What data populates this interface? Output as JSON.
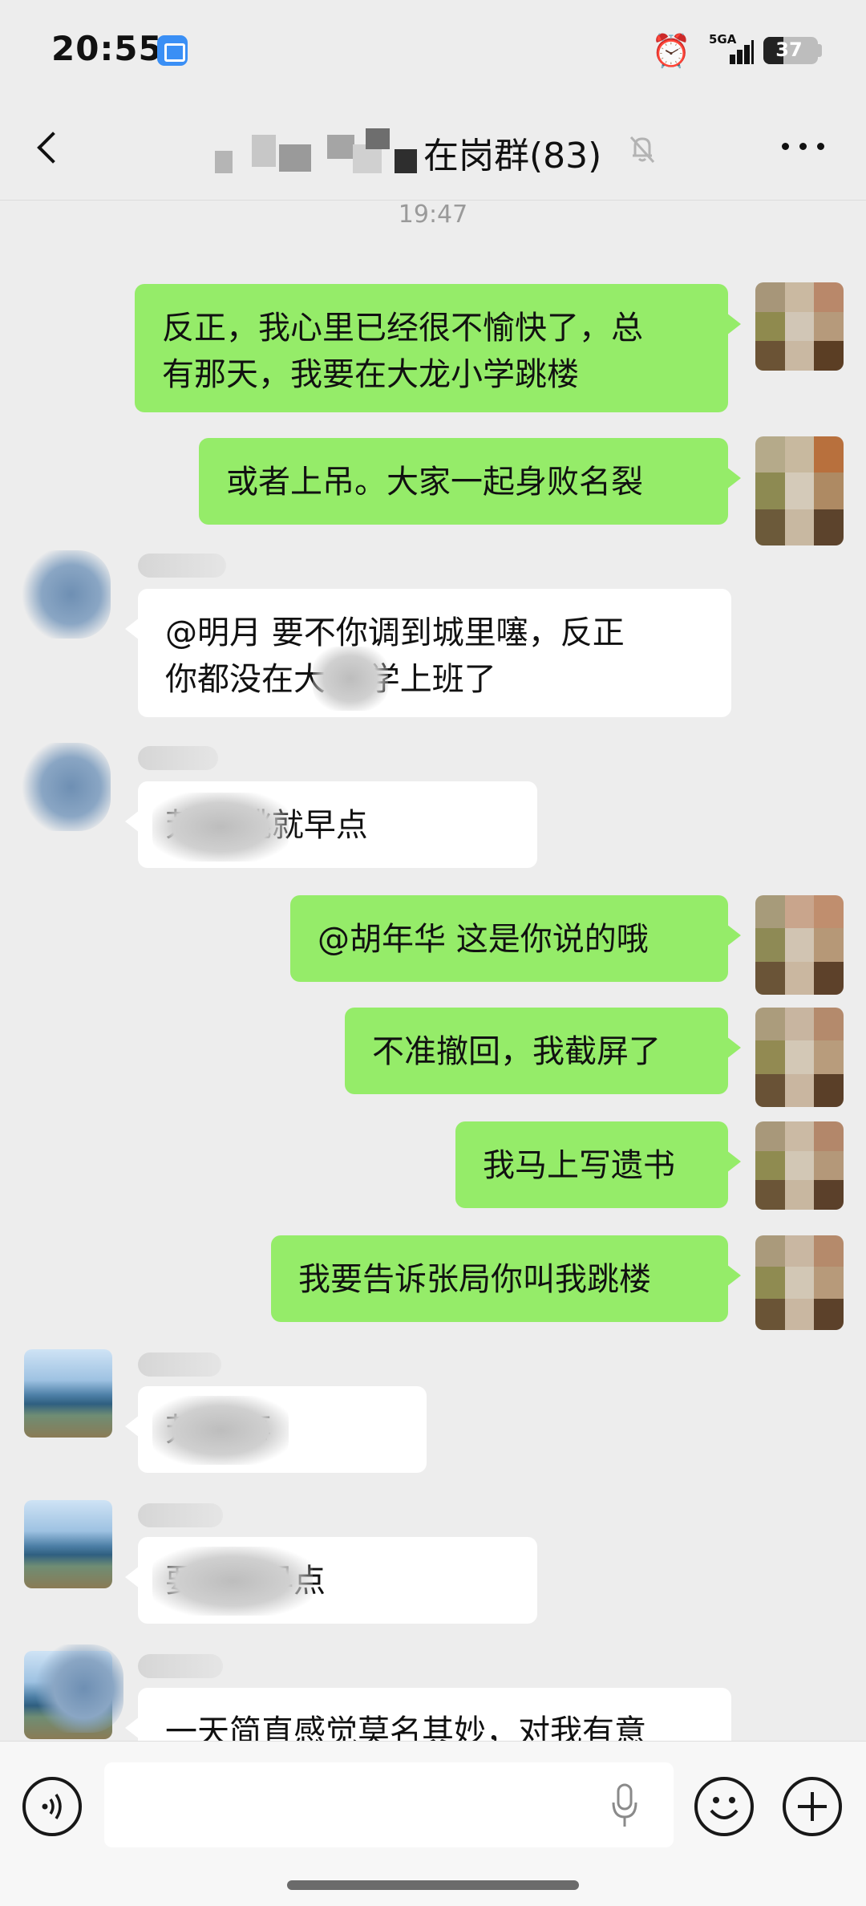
{
  "status_bar": {
    "time": "20:55",
    "network": "5GA",
    "battery": "37",
    "battery_level": 0.37,
    "icons": [
      "app-notification-icon",
      "alarm-icon",
      "signal-icon",
      "battery-icon"
    ]
  },
  "nav": {
    "back_icon": "chevron-left-icon",
    "title_visible": "在岗群(83)",
    "mute_icon": "bell-off-icon",
    "more_icon": "ellipsis-icon"
  },
  "chat": {
    "timestamp": "19:47",
    "messages": [
      {
        "side": "out",
        "text": "反正，我心里已经很不愉快了，总\n有那天，我要在大龙小学跳楼"
      },
      {
        "side": "out",
        "text": "或者上吊。大家一起身败名裂"
      },
      {
        "side": "in",
        "text": "@明月  要不你调到城里噻，反正\n你都没在大  小学上班了"
      },
      {
        "side": "in",
        "text": "        芳  要跳就早点"
      },
      {
        "side": "out",
        "text": "@胡年华  这是你说的哦"
      },
      {
        "side": "out",
        "text": "不准撤回，我截屏了"
      },
      {
        "side": "out",
        "text": "我马上写遗书"
      },
      {
        "side": "out",
        "text": "我要告诉张局你叫我跳楼"
      },
      {
        "side": "in",
        "text": "        芳  没事"
      },
      {
        "side": "in",
        "text": "            要告就早点"
      },
      {
        "side": "in",
        "text": "一天简直感觉莫名其妙，对我有意"
      }
    ]
  },
  "input_bar": {
    "voice_icon": "voice-icon",
    "mic_icon": "microphone-icon",
    "emoji_icon": "emoji-icon",
    "plus_icon": "plus-icon"
  }
}
